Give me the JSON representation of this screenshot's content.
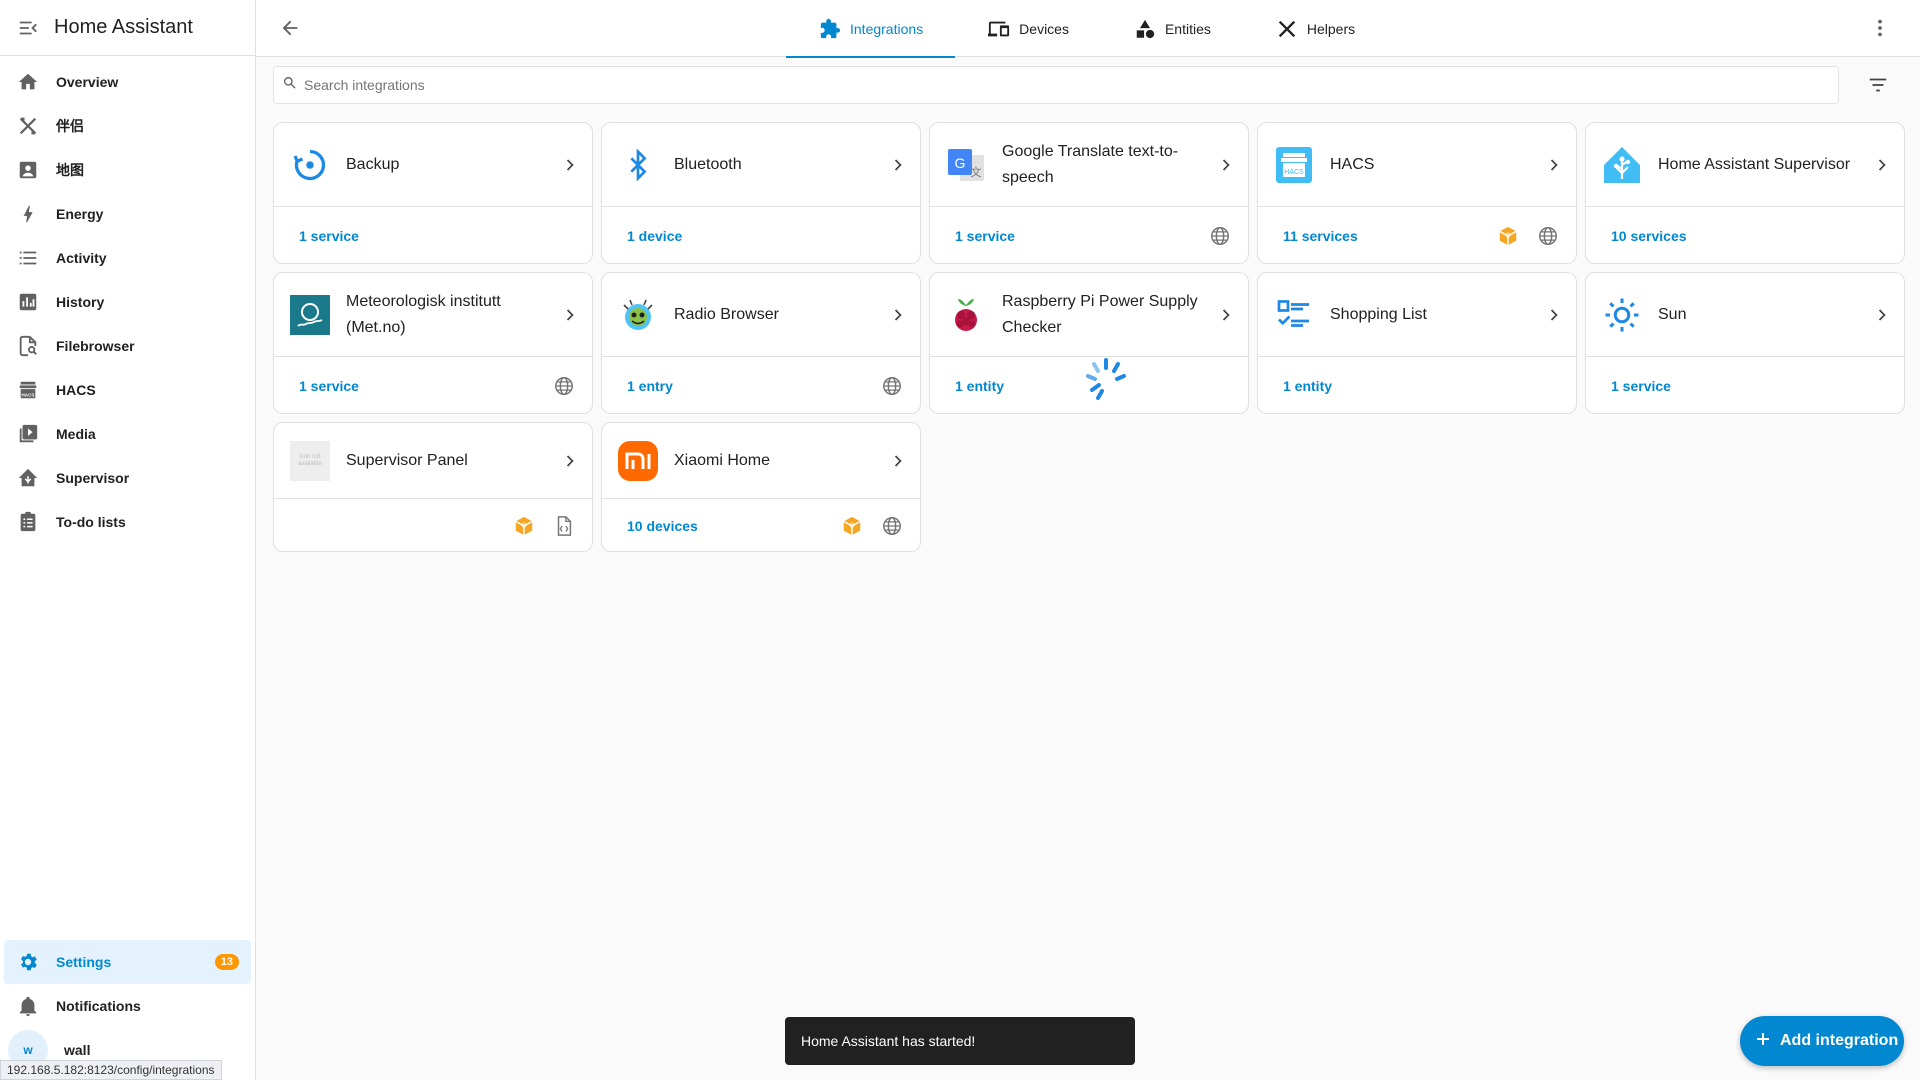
{
  "app": {
    "title": "Home Assistant"
  },
  "sidebar": {
    "items": [
      {
        "label": "Overview",
        "icon": "home-icon"
      },
      {
        "label": "伴侣",
        "icon": "tools-icon"
      },
      {
        "label": "地图",
        "icon": "map-icon"
      },
      {
        "label": "Energy",
        "icon": "lightning-icon"
      },
      {
        "label": "Activity",
        "icon": "list-icon"
      },
      {
        "label": "History",
        "icon": "chart-icon"
      },
      {
        "label": "Filebrowser",
        "icon": "file-search-icon"
      },
      {
        "label": "HACS",
        "icon": "hacs-icon"
      },
      {
        "label": "Media",
        "icon": "media-icon"
      },
      {
        "label": "Supervisor",
        "icon": "supervisor-icon"
      },
      {
        "label": "To-do lists",
        "icon": "clipboard-icon"
      }
    ],
    "settings": {
      "label": "Settings",
      "badge": "13"
    },
    "notifications": {
      "label": "Notifications"
    },
    "user": {
      "initial": "w",
      "name": "wall"
    }
  },
  "tabs": [
    {
      "label": "Integrations",
      "active": true
    },
    {
      "label": "Devices",
      "active": false
    },
    {
      "label": "Entities",
      "active": false
    },
    {
      "label": "Helpers",
      "active": false
    }
  ],
  "search": {
    "placeholder": "Search integrations",
    "value": ""
  },
  "cards": [
    {
      "title": "Backup",
      "link": "1 service",
      "icons": []
    },
    {
      "title": "Bluetooth",
      "link": "1 device",
      "icons": []
    },
    {
      "title": "Google Translate text-to-speech",
      "link": "1 service",
      "icons": [
        "globe-icon"
      ]
    },
    {
      "title": "HACS",
      "link": "11 services",
      "icons": [
        "custom-package-icon",
        "globe-icon"
      ]
    },
    {
      "title": "Home Assistant Supervisor",
      "link": "10 services",
      "icons": []
    },
    {
      "title": "Meteorologisk institutt (Met.no)",
      "link": "1 service",
      "icons": [
        "globe-icon"
      ]
    },
    {
      "title": "Radio Browser",
      "link": "1 entry",
      "icons": [
        "globe-icon"
      ]
    },
    {
      "title": "Raspberry Pi Power Supply Checker",
      "link": "1 entity",
      "icons": []
    },
    {
      "title": "Shopping List",
      "link": "1 entity",
      "icons": []
    },
    {
      "title": "Sun",
      "link": "1 service",
      "icons": []
    },
    {
      "title": "Supervisor Panel",
      "link": "",
      "icons": [
        "custom-package-icon",
        "yaml-file-icon"
      ]
    },
    {
      "title": "Xiaomi Home",
      "link": "10 devices",
      "icons": [
        "custom-package-icon",
        "globe-icon"
      ]
    }
  ],
  "supervisor_panel_logo_text": "icon not available",
  "snackbar": {
    "message": "Home Assistant has started!"
  },
  "fab": {
    "label": "Add integration"
  },
  "status_bar": {
    "url": "192.168.5.182:8123/config/integrations"
  },
  "colors": {
    "primary": "#0288d1",
    "badge": "#ff9800",
    "custom": "#f5a623"
  }
}
